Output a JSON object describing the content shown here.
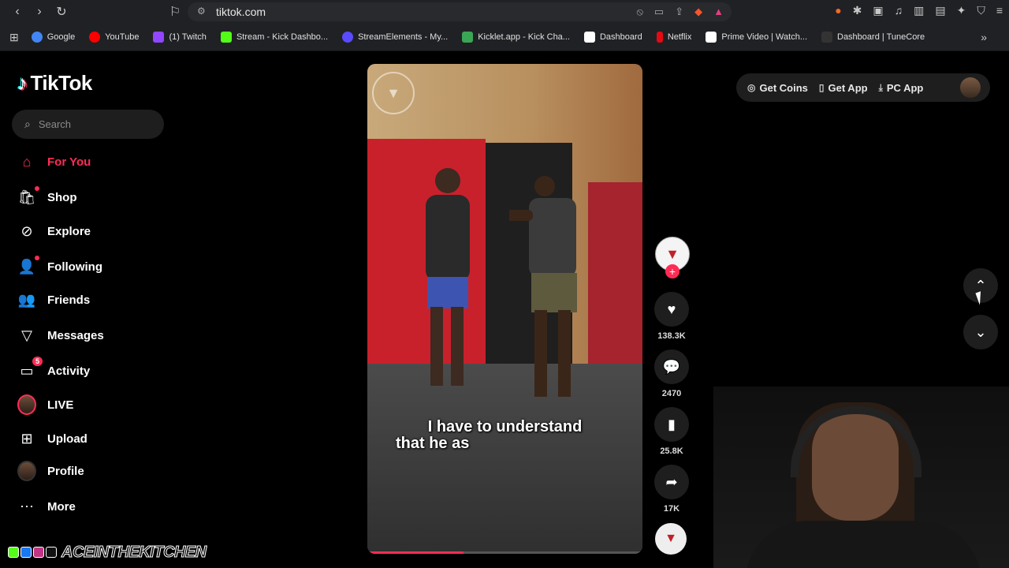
{
  "browser": {
    "url": "tiktok.com",
    "bookmarks": [
      {
        "label": "Google",
        "color": "#4285f4"
      },
      {
        "label": "YouTube",
        "color": "#ff0000"
      },
      {
        "label": "(1) Twitch",
        "color": "#9146ff"
      },
      {
        "label": "Stream - Kick Dashbo...",
        "color": "#53fc18"
      },
      {
        "label": "StreamElements - My...",
        "color": "#5a4bff"
      },
      {
        "label": "Kicklet.app - Kick Cha...",
        "color": "#3aa655"
      },
      {
        "label": "Dashboard",
        "color": "#ffffff"
      },
      {
        "label": "Netflix",
        "color": "#e50914"
      },
      {
        "label": "Prime Video | Watch...",
        "color": "#ffffff"
      },
      {
        "label": "Dashboard | TuneCore",
        "color": "#1e1e1e"
      }
    ]
  },
  "app": {
    "logo": "TikTok",
    "search_placeholder": "Search"
  },
  "sidebar": {
    "items": [
      {
        "label": "For You",
        "icon": "home-icon",
        "active": true
      },
      {
        "label": "Shop",
        "icon": "shop-icon"
      },
      {
        "label": "Explore",
        "icon": "compass-icon"
      },
      {
        "label": "Following",
        "icon": "following-icon"
      },
      {
        "label": "Friends",
        "icon": "friends-icon"
      },
      {
        "label": "Messages",
        "icon": "messages-icon"
      },
      {
        "label": "Activity",
        "icon": "activity-icon",
        "badge": "5"
      },
      {
        "label": "LIVE",
        "icon": "live-avatar-icon"
      },
      {
        "label": "Upload",
        "icon": "upload-icon"
      },
      {
        "label": "Profile",
        "icon": "profile-avatar-icon"
      },
      {
        "label": "More",
        "icon": "more-icon"
      }
    ]
  },
  "video": {
    "caption_line1": "I have to understand",
    "caption_line2": "that he as",
    "progress": 0.35
  },
  "actions": {
    "likes": "138.3K",
    "comments": "2470",
    "saves": "25.8K",
    "shares": "17K"
  },
  "topbar": {
    "get_coins": "Get Coins",
    "get_app": "Get App",
    "pc_app": "PC App"
  },
  "overlay": {
    "channel": "ACEINTHEKITCHEN"
  },
  "colors": {
    "accent": "#fe2c55",
    "background": "#000000"
  }
}
